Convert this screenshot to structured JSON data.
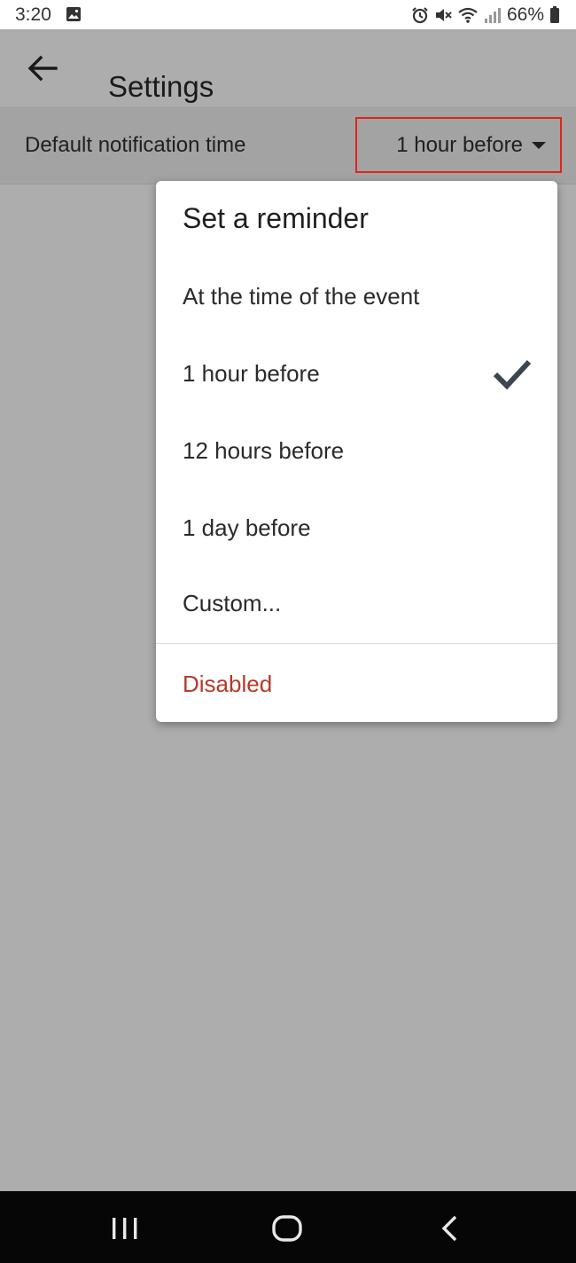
{
  "status_bar": {
    "time": "3:20",
    "battery": "66%",
    "icons": [
      "gallery-icon",
      "alarm-icon",
      "mute-icon",
      "wifi-icon",
      "signal-icon",
      "battery-icon"
    ]
  },
  "app_bar": {
    "title": "Settings",
    "back_icon": "arrow-left-icon"
  },
  "setting": {
    "label": "Default notification time",
    "value": "1 hour before",
    "caret_icon": "caret-down-icon"
  },
  "popup": {
    "title": "Set a reminder",
    "options": [
      {
        "label": "At the time of the event",
        "selected": false
      },
      {
        "label": "1 hour before",
        "selected": true
      },
      {
        "label": "12 hours before",
        "selected": false
      },
      {
        "label": "1 day before",
        "selected": false
      },
      {
        "label": "Custom...",
        "selected": false
      }
    ],
    "disabled_label": "Disabled",
    "check_icon": "checkmark-icon"
  },
  "nav_bar": {
    "icons": [
      "recents-icon",
      "home-icon",
      "back-icon"
    ]
  },
  "colors": {
    "dim_background": "#adadad",
    "highlight_border": "#e1251b",
    "disabled_text": "#b63a2a",
    "check": "#3d4550"
  }
}
